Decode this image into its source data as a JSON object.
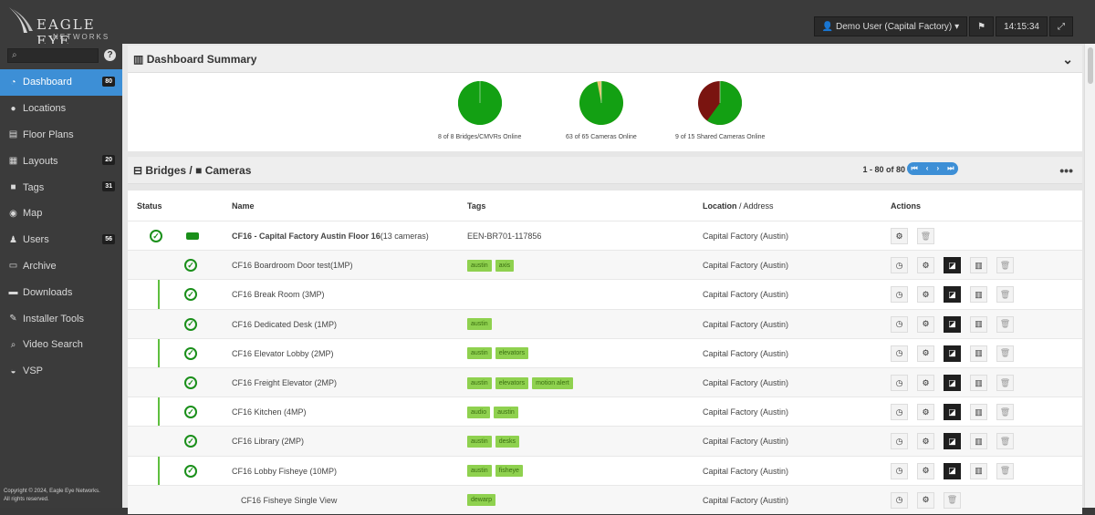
{
  "brand": {
    "name": "EAGLE EYE",
    "sub": "NETWORKS"
  },
  "topbar": {
    "user": "Demo User (Capital Factory)",
    "time": "14:15:34"
  },
  "sidebar": {
    "search_placeholder": "",
    "help": "?",
    "items": [
      {
        "label": "Dashboard",
        "icon": "dashboard-icon",
        "badge": "80",
        "active": true
      },
      {
        "label": "Locations",
        "icon": "map-pin-icon",
        "badge": ""
      },
      {
        "label": "Floor Plans",
        "icon": "floor-plan-icon",
        "badge": ""
      },
      {
        "label": "Layouts",
        "icon": "grid-icon",
        "badge": "20"
      },
      {
        "label": "Tags",
        "icon": "video-camera-icon",
        "badge": "31"
      },
      {
        "label": "Map",
        "icon": "globe-icon",
        "badge": ""
      },
      {
        "label": "Users",
        "icon": "users-icon",
        "badge": "56"
      },
      {
        "label": "Archive",
        "icon": "folder-icon",
        "badge": ""
      },
      {
        "label": "Downloads",
        "icon": "film-icon",
        "badge": ""
      },
      {
        "label": "Installer Tools",
        "icon": "wrench-icon",
        "badge": ""
      },
      {
        "label": "Video Search",
        "icon": "search-icon",
        "badge": ""
      },
      {
        "label": "VSP",
        "icon": "car-icon",
        "badge": ""
      }
    ],
    "copyright": [
      "Copyright © 2024, Eagle Eye Networks.",
      "All rights reserved."
    ]
  },
  "dashboard": {
    "title": "Dashboard Summary",
    "pies": [
      {
        "label": "8 of 8 Bridges/CMVRs Online",
        "online": 8,
        "total": 8,
        "color": "#13a013",
        "other": "#13a013"
      },
      {
        "label": "63 of 65 Cameras Online",
        "online": 63,
        "total": 65,
        "color": "#13a013",
        "other": "#e8c46a"
      },
      {
        "label": "9 of 15 Shared Cameras Online",
        "online": 9,
        "total": 15,
        "color": "#13a013",
        "other": "#7a1410"
      }
    ]
  },
  "cameras": {
    "title": "Bridges / ",
    "title2": "Cameras",
    "range": "1 - 80 of 80",
    "more": "•••",
    "headers": {
      "status": "Status",
      "name": "Name",
      "tags": "Tags",
      "location": "Location",
      "address": " / Address",
      "actions": "Actions"
    },
    "rows": [
      {
        "type": "bridge",
        "name": "CF16 - Capital Factory Austin Floor 16",
        "count": " (13 cameras)",
        "tags": [],
        "tag_text": "EEN-BR701-117856",
        "location": "Capital Factory (Austin)"
      },
      {
        "type": "camera",
        "name": "CF16 Boardroom Door test(1MP)",
        "tags": [
          "austin",
          "axis"
        ],
        "location": "Capital Factory (Austin)"
      },
      {
        "type": "camera",
        "name": "CF16 Break Room (3MP)",
        "tags": [],
        "location": "Capital Factory (Austin)"
      },
      {
        "type": "camera",
        "name": "CF16 Dedicated Desk (1MP)",
        "tags": [
          "austin"
        ],
        "location": "Capital Factory (Austin)"
      },
      {
        "type": "camera",
        "name": "CF16 Elevator Lobby (2MP)",
        "tags": [
          "austin",
          "elevators"
        ],
        "location": "Capital Factory (Austin)"
      },
      {
        "type": "camera",
        "name": "CF16 Freight Elevator (2MP)",
        "tags": [
          "austin",
          "elevators",
          "motion alert"
        ],
        "location": "Capital Factory (Austin)"
      },
      {
        "type": "camera",
        "name": "CF16 Kitchen (4MP)",
        "tags": [
          "audio",
          "austin"
        ],
        "location": "Capital Factory (Austin)"
      },
      {
        "type": "camera",
        "name": "CF16 Library (2MP)",
        "tags": [
          "austin",
          "desks"
        ],
        "location": "Capital Factory (Austin)"
      },
      {
        "type": "camera",
        "name": "CF16 Lobby Fisheye (10MP)",
        "tags": [
          "austin",
          "fisheye"
        ],
        "location": "Capital Factory (Austin)"
      },
      {
        "type": "sub",
        "name": "CF16 Fisheye Single View",
        "tags": [
          "dewarp"
        ],
        "location": "Capital Factory (Austin)"
      }
    ]
  }
}
